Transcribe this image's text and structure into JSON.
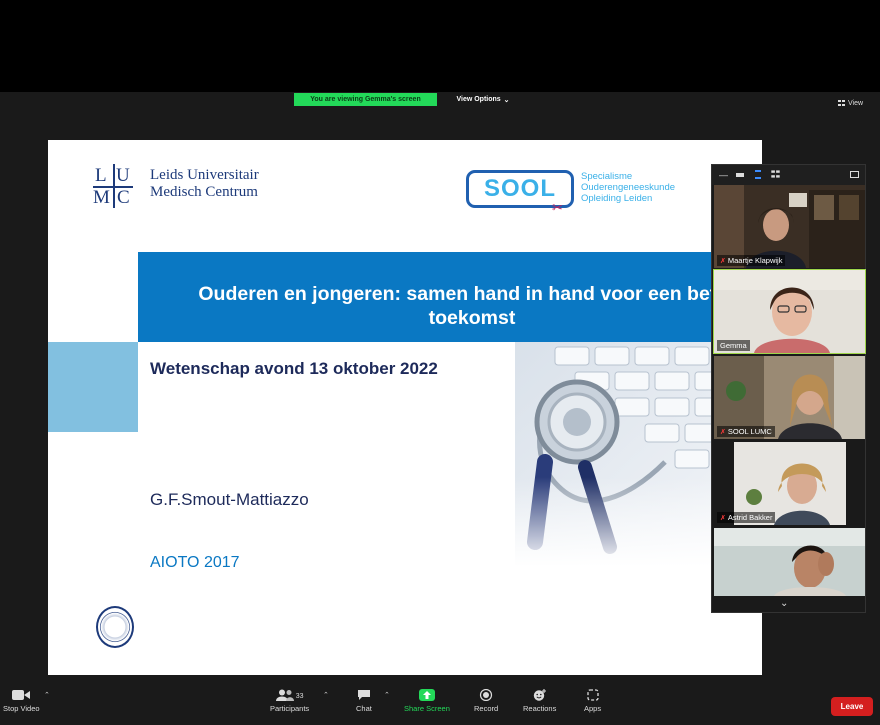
{
  "share_banner": {
    "viewing_text": "You are viewing Gemma's screen",
    "view_options_label": "View Options",
    "view_label": "View"
  },
  "slide": {
    "lumc_letters": [
      "L",
      "U",
      "M",
      "C"
    ],
    "institution_line1": "Leids Universitair",
    "institution_line2": "Medisch Centrum",
    "sool_logo_text": "SOOL",
    "sool_line1": "Specialisme",
    "sool_line2": "Ouderengeneeskunde",
    "sool_line3": "Opleiding Leiden",
    "title_line1": "Ouderen en jongeren: samen hand in hand voor een betere",
    "title_line2": "toekomst",
    "event_date": "Wetenschap avond 13 oktober 2022",
    "presenter": "G.F.Smout-Mattiazzo",
    "affiliation": "AIOTO 2017"
  },
  "participants_panel": {
    "tiles": [
      {
        "name": "Maartje Klapwijk",
        "muted": true
      },
      {
        "name": "Gemma",
        "muted": false
      },
      {
        "name": "SOOL LUMC",
        "muted": true
      },
      {
        "name": "Astrid Bakker",
        "muted": true
      },
      {
        "name": "",
        "muted": false
      }
    ]
  },
  "toolbar": {
    "stop_video": "Stop Video",
    "participants": "Participants",
    "participants_count": "33",
    "chat": "Chat",
    "share_screen": "Share Screen",
    "record": "Record",
    "reactions": "Reactions",
    "apps": "Apps",
    "leave": "Leave"
  },
  "colors": {
    "share_green": "#23d959",
    "slide_blue": "#0a78c3",
    "leave_red": "#d41f1f"
  }
}
